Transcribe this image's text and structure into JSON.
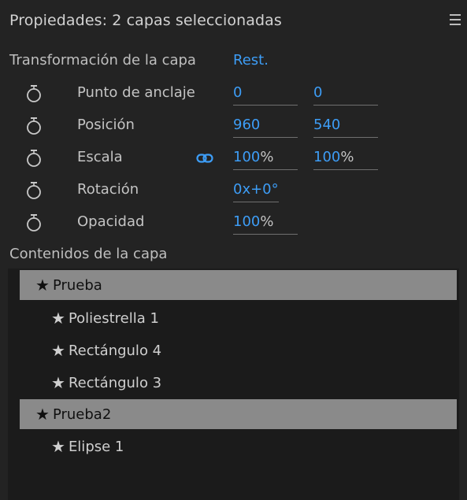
{
  "header": {
    "title": "Propiedades: 2 capas seleccionadas",
    "menu_icon": "hamburger-menu-icon"
  },
  "transform": {
    "title": "Transformación de la capa",
    "reset_label": "Rest.",
    "stopwatch_icon": "stopwatch-icon",
    "link_icon": "chain-link-icon",
    "properties": {
      "anchor": {
        "label": "Punto de anclaje",
        "x": "0",
        "y": "0"
      },
      "position": {
        "label": "Posición",
        "x": "960",
        "y": "540"
      },
      "scale": {
        "label": "Escala",
        "x": "100",
        "y": "100",
        "unit": "%"
      },
      "rotation": {
        "label": "Rotación",
        "value": "0x+0°"
      },
      "opacity": {
        "label": "Opacidad",
        "value": "100",
        "unit": "%"
      }
    }
  },
  "contents": {
    "title": "Contenidos de la capa",
    "star_icon": "star-icon",
    "items": [
      {
        "label": "Prueba",
        "selected": true,
        "level": 0
      },
      {
        "label": "Poliestrella 1",
        "selected": false,
        "level": 1
      },
      {
        "label": "Rectángulo 4",
        "selected": false,
        "level": 1
      },
      {
        "label": "Rectángulo 3",
        "selected": false,
        "level": 1
      },
      {
        "label": "Prueba2",
        "selected": true,
        "level": 0
      },
      {
        "label": "Elipse 1",
        "selected": false,
        "level": 1
      }
    ]
  },
  "colors": {
    "background": "#232323",
    "contents_background": "#1b1b1b",
    "accent": "#3d9df6",
    "selection": "#8a8a8a"
  }
}
